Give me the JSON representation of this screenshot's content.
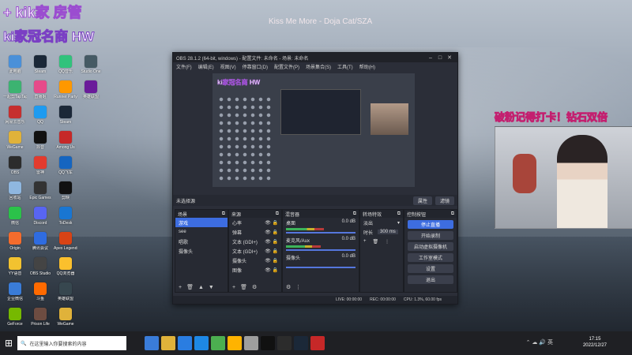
{
  "now_playing": "Kiss Me More - Doja Cat/SZA",
  "overlay": {
    "title_line1": "+ kik家 房管",
    "title_badge": "kik家",
    "title_line2": "ki家冠名商 HW",
    "right_banner": "破粉记得打卡！钻石双倍"
  },
  "desktop_icons": [
    {
      "label": "此电脑",
      "color": "#4a90d9"
    },
    {
      "label": "一起剪TapTap",
      "color": "#3cb371"
    },
    {
      "label": "网易云音乐",
      "color": "#c62f2f"
    },
    {
      "label": "WeGame",
      "color": "#e0b23a"
    },
    {
      "label": "OBS",
      "color": "#2c2c2c"
    },
    {
      "label": "回收站",
      "color": "#8fb7e0"
    },
    {
      "label": "微信",
      "color": "#2bc24a"
    },
    {
      "label": "Origin",
      "color": "#f56c2d"
    },
    {
      "label": "YY语音",
      "color": "#f2c230"
    },
    {
      "label": "企业微信",
      "color": "#3a7cd8"
    },
    {
      "label": "GeForce",
      "color": "#76b900"
    },
    {
      "label": "网易UU",
      "color": "#2f5aa8"
    },
    {
      "label": "Steam",
      "color": "#1b2838"
    },
    {
      "label": "直播姬",
      "color": "#e64a8a"
    },
    {
      "label": "QQ",
      "color": "#1e9bf0"
    },
    {
      "label": "抖音",
      "color": "#111111"
    },
    {
      "label": "雷神",
      "color": "#e33b2e"
    },
    {
      "label": "Epic Games",
      "color": "#333333"
    },
    {
      "label": "Discord",
      "color": "#5865f2"
    },
    {
      "label": "腾讯会议",
      "color": "#2f6ce0"
    },
    {
      "label": "OBS Studio",
      "color": "#444444"
    },
    {
      "label": "斗鱼",
      "color": "#ff6a00"
    },
    {
      "label": "Prison Life",
      "color": "#6d4c41"
    },
    {
      "label": "叉兮",
      "color": "#2e7d32"
    },
    {
      "label": "QQ音乐",
      "color": "#31c27c"
    },
    {
      "label": "Runner Party",
      "color": "#ff9800"
    },
    {
      "label": "Steam",
      "color": "#1b2838"
    },
    {
      "label": "Among Us",
      "color": "#c62828"
    },
    {
      "label": "QQ飞车",
      "color": "#1565c0"
    },
    {
      "label": "剪映",
      "color": "#111111"
    },
    {
      "label": "ToDesk",
      "color": "#1976d2"
    },
    {
      "label": "Apex Legends",
      "color": "#d84315"
    },
    {
      "label": "QQ浏览器",
      "color": "#fbc02d"
    },
    {
      "label": "英雄联盟",
      "color": "#37474f"
    },
    {
      "label": "WeGame",
      "color": "#e0b23a"
    },
    {
      "label": "Counter-Strike",
      "color": "#ef6c00"
    },
    {
      "label": "Studio One",
      "color": "#455a64"
    },
    {
      "label": "英雄联盟",
      "color": "#6a1b9a"
    }
  ],
  "obs": {
    "window_title": "OBS 28.1.2 (64-bit, windows) - 配置文件: 未命名 - 场景: 未命名",
    "menu": [
      "文件(F)",
      "编辑(E)",
      "视图(V)",
      "停靠窗口(D)",
      "配置文件(P)",
      "场景集合(S)",
      "工具(T)",
      "帮助(H)"
    ],
    "preview_title": "ki家冠名商 HW",
    "no_source": "未选择源",
    "prop_btn": "属性",
    "filter_btn": "滤镜",
    "docks": {
      "scenes": {
        "title": "场景",
        "items": [
          "游戏",
          "see",
          "唱歌",
          "摄像头"
        ],
        "selected": 0
      },
      "sources": {
        "title": "来源",
        "items": [
          "心率",
          "弹幕",
          "文本 (GDI+)",
          "文本 (GDI+)",
          "摄像头",
          "图像"
        ]
      },
      "mixer": {
        "title": "混音器",
        "channels": [
          {
            "name": "桌面",
            "db": "0.0 dB",
            "level": 0.55
          },
          {
            "name": "麦克风/Aux",
            "db": "0.0 dB",
            "level": 0.5
          },
          {
            "name": "摄像头",
            "db": "0.0 dB",
            "level": 0.0
          }
        ]
      },
      "transitions": {
        "title": "转场特效",
        "type": "淡出",
        "duration_label": "时长",
        "duration": "300 ms"
      },
      "controls": {
        "title": "控制按钮",
        "buttons": [
          "停止直播",
          "开始录制",
          "启动虚拟摄像机",
          "工作室模式",
          "设置",
          "退出"
        ]
      }
    },
    "status": {
      "live": "LIVE: 00:00:00",
      "rec": "REC: 00:00:00",
      "cpu": "CPU: 1.3%, 60.00 fps"
    }
  },
  "taskbar": {
    "search_placeholder": "在这里输入你要搜索的内容",
    "time": "17:15",
    "date": "2022/12/27"
  }
}
